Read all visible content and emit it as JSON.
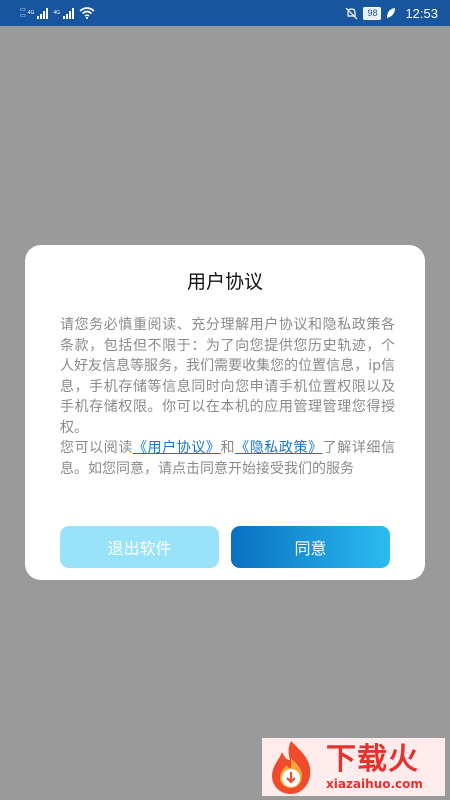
{
  "status_bar": {
    "net_1": "4G",
    "net_2": "4G",
    "battery": "98",
    "time": "12:53",
    "icons": [
      "sim1-signal-icon",
      "sim2-signal-icon",
      "wifi-icon",
      "mute-icon",
      "battery-icon",
      "leaf-icon"
    ]
  },
  "dialog": {
    "title": "用户协议",
    "paragraph1": "请您务必慎重阅读、充分理解用户协议和隐私政策各条款，包括但不限于：为了向您提供您历史轨迹，个人好友信息等服务，我们需要收集您的位置信息，ip信息，手机存储等信息同时向您申请手机位置权限以及手机存储权限。你可以在本机的应用管理管理您得授权。",
    "paragraph2_prefix": "您可以阅读",
    "user_agreement_link": "《用户协议》",
    "connector": "和",
    "privacy_policy_link": "《隐私政策》",
    "paragraph2_suffix": "了解详细信息。如您同意，请点击同意开始接受我们的服务",
    "exit_button": "退出软件",
    "agree_button": "同意"
  },
  "watermark": {
    "brand": "下载火",
    "url": "xiazaihuo.com"
  },
  "colors": {
    "status_bar": "#17569e",
    "overlay": "#9a9a9a",
    "exit_button": "#98e2fa",
    "agree_gradient_start": "#0a70c2",
    "agree_gradient_end": "#2bbcf0",
    "link": "#1875c9",
    "watermark": "#e5322d"
  }
}
